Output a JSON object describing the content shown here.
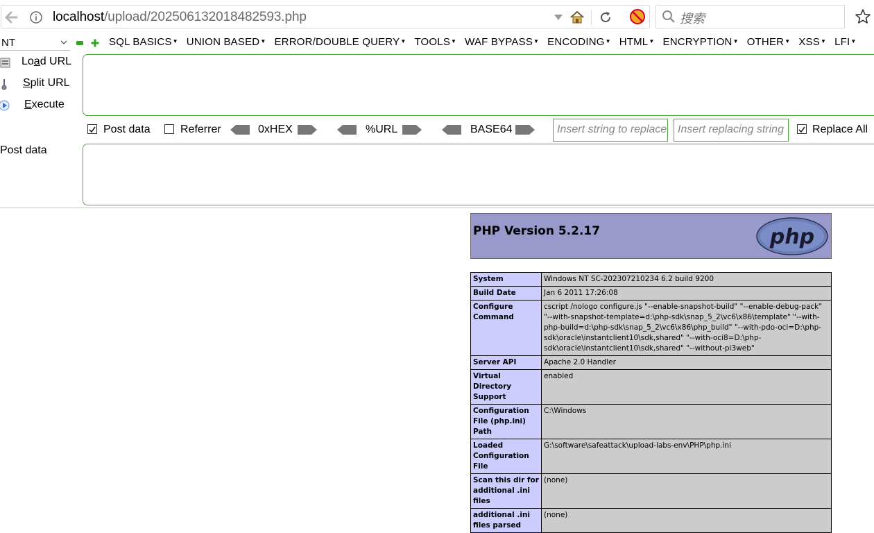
{
  "browser": {
    "url_host": "localhost",
    "url_path": "/upload/202506132018482593.php",
    "search_placeholder": "搜索"
  },
  "hackbar": {
    "select_value": "NT",
    "menu": [
      {
        "label": "SQL BASICS"
      },
      {
        "label": "UNION BASED"
      },
      {
        "label": "ERROR/DOUBLE QUERY"
      },
      {
        "label": "TOOLS"
      },
      {
        "label": "WAF BYPASS"
      },
      {
        "label": "ENCODING"
      },
      {
        "label": "HTML"
      },
      {
        "label": "ENCRYPTION"
      },
      {
        "label": "OTHER"
      },
      {
        "label": "XSS"
      },
      {
        "label": "LFI"
      }
    ],
    "load_url_pre": "Lo",
    "load_url_ul": "a",
    "load_url_post": "d URL",
    "split_url_ul": "S",
    "split_url_post": "plit URL",
    "execute_ul": "E",
    "execute_post": "xecute",
    "post_data_checkbox": "Post data",
    "post_data_checked": true,
    "referrer_checkbox": "Referrer",
    "referrer_checked": false,
    "hex_label": "0xHEX",
    "url_label": "%URL",
    "base64_label": "BASE64",
    "replace_placeholder": "Insert string to replace",
    "replacing_placeholder": "Insert replacing string",
    "replace_all_label": "Replace All",
    "replace_all_checked": true,
    "post_data_label": "Post data"
  },
  "phpinfo": {
    "title": "PHP Version 5.2.17",
    "logo_text": "php",
    "rows": [
      {
        "key": "System",
        "value": "Windows NT SC-202307210234 6.2 build 9200"
      },
      {
        "key": "Build Date",
        "value": "Jan 6 2011 17:26:08"
      },
      {
        "key": "Configure Command",
        "value": "cscript /nologo configure.js \"--enable-snapshot-build\" \"--enable-debug-pack\" \"--with-snapshot-template=d:\\php-sdk\\snap_5_2\\vc6\\x86\\template\" \"--with-php-build=d:\\php-sdk\\snap_5_2\\vc6\\x86\\php_build\" \"--with-pdo-oci=D:\\php-sdk\\oracle\\instantclient10\\sdk,shared\" \"--with-oci8=D:\\php-sdk\\oracle\\instantclient10\\sdk,shared\" \"--without-pi3web\""
      },
      {
        "key": "Server API",
        "value": "Apache 2.0 Handler"
      },
      {
        "key": "Virtual Directory Support",
        "value": "enabled"
      },
      {
        "key": "Configuration File (php.ini) Path",
        "value": "C:\\Windows"
      },
      {
        "key": "Loaded Configuration File",
        "value": "G:\\software\\safeattack\\upload-labs-env\\PHP\\php.ini"
      },
      {
        "key": "Scan this dir for additional .ini files",
        "value": "(none)"
      },
      {
        "key": "additional .ini files parsed",
        "value": "(none)"
      }
    ]
  }
}
